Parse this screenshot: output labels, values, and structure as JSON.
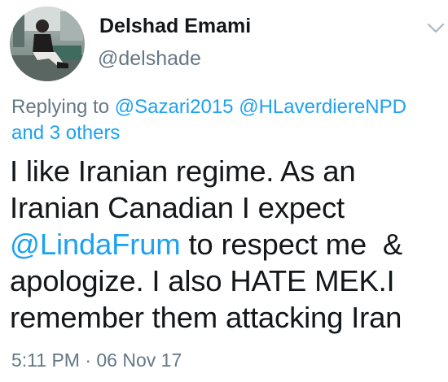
{
  "author": {
    "display_name": "Delshad Emami",
    "handle": "@delshade"
  },
  "reply_context": {
    "prefix": "Replying to ",
    "mention_1": "@Sazari2015",
    "mention_2": "@HLaverdiereNPD",
    "others": "and 3 others"
  },
  "tweet": {
    "line_1": "I like Iranian regime. As an",
    "line_2": "Iranian Canadian I expect",
    "line_3_mention": "@LindaFrum",
    "line_3_rest": " to respect me  &",
    "line_4": "apologize. I also HATE MEK.I",
    "line_5": "remember them attacking Iran"
  },
  "meta": {
    "timestamp": "5:11 PM · 06 Nov 17"
  },
  "icons": {
    "menu": "chevron-down-icon"
  },
  "colors": {
    "link": "#1da1f2",
    "secondary_text": "#657786",
    "primary_text": "#14171a"
  }
}
